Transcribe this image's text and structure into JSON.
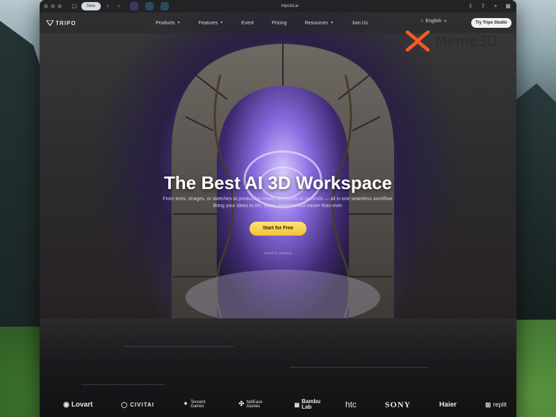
{
  "browser": {
    "tab_pill_label": "New",
    "url": "tripo3d.ai"
  },
  "nav": {
    "logo_text": "TRIPO",
    "links": [
      "Products",
      "Features",
      "Event",
      "Pricing",
      "Resources",
      "Join Us"
    ],
    "language": "English",
    "try_button": "Try Tripo Studio"
  },
  "hero": {
    "title": "The Best AI 3D Workspace",
    "subtitle_line1": "From texts, images, or sketches to production-ready 3D Assets in seconds — all in one seamless workflow.",
    "subtitle_line2": "Bring your ideas to life, faster, smarter, and easier than ever.",
    "cta": "Start for Free",
    "secondary_link": "Install for Desktop"
  },
  "partners": [
    "Lovart",
    "CIVITAI",
    "Tencent Games",
    "NetEase Games",
    "Bambu Lab",
    "htc",
    "SONY",
    "Haier",
    "replit"
  ],
  "watermark": "Meme3D",
  "colors": {
    "accent_yellow": "#f2c231",
    "portal_purple": "#8c6fe0",
    "watermark_orange": "#f15a22"
  }
}
